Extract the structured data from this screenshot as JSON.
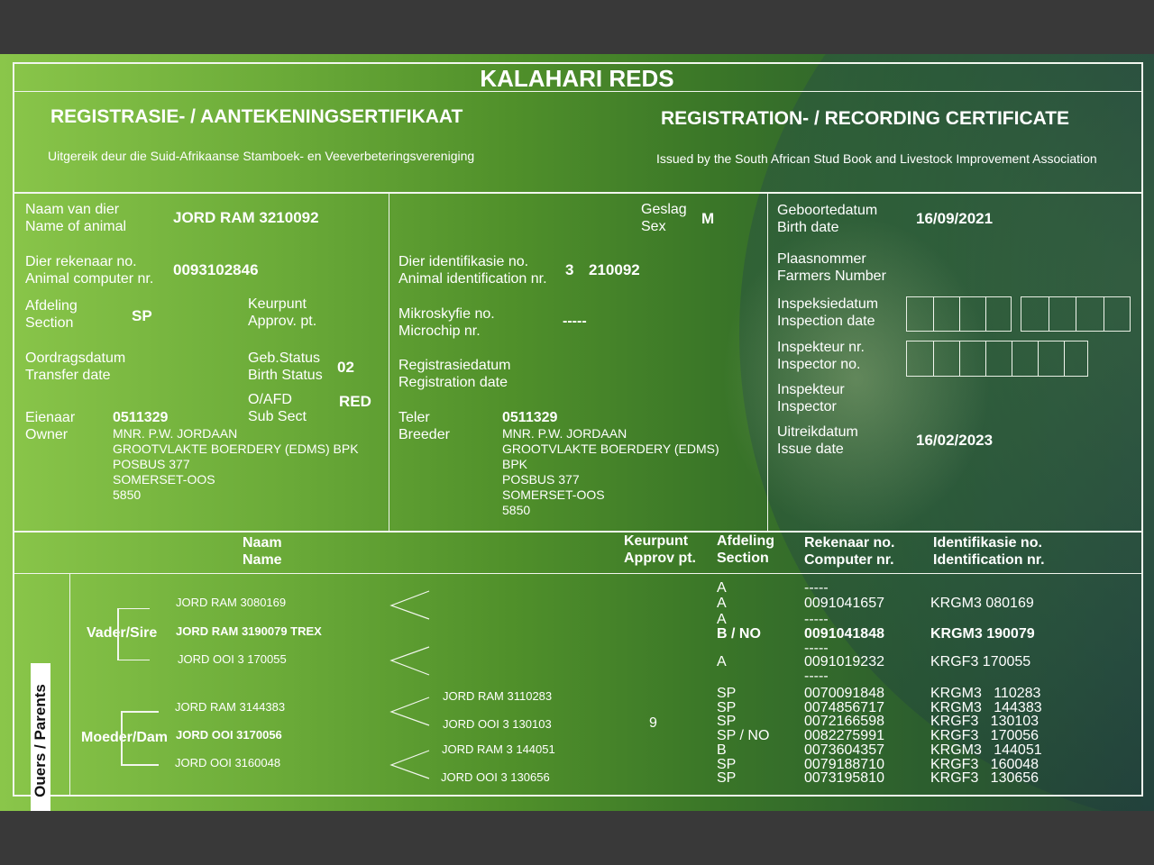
{
  "header": {
    "breed": "KALAHARI REDS",
    "title_af": "REGISTRASIE- / AANTEKENINGSERTIFIKAAT",
    "title_en": "REGISTRATION- / RECORDING CERTIFICATE",
    "issuer_af": "Uitgereik deur die Suid-Afrikaanse Stamboek- en Veeverbeteringsvereniging",
    "issuer_en": "Issued by the South African Stud Book and Livestock Improvement Association"
  },
  "labels": {
    "name_af": "Naam van dier",
    "name_en": "Name of animal",
    "comp_af": "Dier rekenaar no.",
    "comp_en": "Animal computer nr.",
    "section_af": "Afdeling",
    "section_en": "Section",
    "approv_af": "Keurpunt",
    "approv_en": "Approv. pt.",
    "transfer_af": "Oordragsdatum",
    "transfer_en": "Transfer date",
    "birthstatus_af": "Geb.Status",
    "birthstatus_en": "Birth Status",
    "subsect_af": "O/AFD",
    "subsect_en": "Sub Sect",
    "owner_af": "Eienaar",
    "owner_en": "Owner",
    "sex_af": "Geslag",
    "sex_en": "Sex",
    "ident_af": "Dier identifikasie no.",
    "ident_en": "Animal identification nr.",
    "micro_af": "Mikroskyfie no.",
    "micro_en": "Microchip nr.",
    "regdate_af": "Registrasiedatum",
    "regdate_en": "Registration date",
    "breeder_af": "Teler",
    "breeder_en": "Breeder",
    "birth_af": "Geboortedatum",
    "birth_en": "Birth date",
    "farm_af": "Plaasnommer",
    "farm_en": "Farmers Number",
    "inspdate_af": "Inspeksiedatum",
    "inspdate_en": "Inspection date",
    "inspno_af": "Inspekteur nr.",
    "inspno_en": "Inspector no.",
    "insp_af": "Inspekteur",
    "insp_en": "Inspector",
    "issue_af": "Uitreikdatum",
    "issue_en": "Issue date"
  },
  "animal": {
    "name": "JORD RAM 3210092",
    "computer_no": "0093102846",
    "section": "SP",
    "birth_status": "02",
    "sub_sect": "RED",
    "sex": "M",
    "id_prefix": "3",
    "id_no": "210092",
    "microchip": "-----",
    "birth_date": "16/09/2021",
    "issue_date": "16/02/2023"
  },
  "owner": {
    "code": "0511329",
    "lines": [
      "MNR. P.W. JORDAAN",
      "GROOTVLAKTE BOERDERY (EDMS) BPK",
      "POSBUS 377",
      "SOMERSET-OOS",
      "5850"
    ]
  },
  "breeder": {
    "code": "0511329",
    "lines": [
      "MNR. P.W. JORDAAN",
      "GROOTVLAKTE BOERDERY (EDMS)",
      "BPK",
      "POSBUS 377",
      "SOMERSET-OOS",
      "5850"
    ]
  },
  "pedigree_header": {
    "name_af": "Naam",
    "name_en": "Name",
    "approv_af": "Keurpunt",
    "approv_en": "Approv pt.",
    "section_af": "Afdeling",
    "section_en": "Section",
    "comp_af": "Rekenaar no.",
    "comp_en": "Computer nr.",
    "ident_af": "Identifikasie no.",
    "ident_en": "Identification nr."
  },
  "pedigree": {
    "side_label": "Ouers / Parents",
    "sire_label": "Vader/Sire",
    "dam_label": "Moeder/Dam",
    "sire": "JORD RAM 3190079 TREX",
    "sire_sire": "JORD RAM 3080169",
    "sire_dam": "JORD OOI 3 170055",
    "dam": "JORD OOI 3170056",
    "dam_sire": "JORD RAM 3144383",
    "dam_dam": "JORD OOI 3160048",
    "dam_sire_sire": "JORD RAM 3110283",
    "dam_sire_dam": "JORD OOI 3 130103",
    "dam_dam_sire": "JORD RAM 3 144051",
    "dam_dam_dam": "JORD OOI 3 130656",
    "dam_approv": "9",
    "sire_rows": [
      {
        "section": "A",
        "computer": "-----",
        "ident": ""
      },
      {
        "section": "A",
        "computer": "0091041657",
        "ident": "KRGM3   080169"
      },
      {
        "section": "A",
        "computer": "-----",
        "ident": ""
      },
      {
        "section": "B / NO",
        "computer": "0091041848",
        "ident": "KRGM3   190079"
      },
      {
        "section": "",
        "computer": "-----",
        "ident": ""
      },
      {
        "section": "A",
        "computer": "0091019232",
        "ident": "KRGF3   170055"
      },
      {
        "section": "",
        "computer": "-----",
        "ident": ""
      }
    ],
    "dam_sections": "SP\nSP\nSP\nSP / NO\nB\nSP\nSP",
    "dam_computers": "0070091848\n0074856717\n0072166598\n0082275991\n0073604357\n0079188710\n0073195810",
    "dam_idents": "KRGM3   110283\nKRGM3   144383\nKRGF3   130103\nKRGF3   170056\nKRGM3   144051\nKRGF3   160048\nKRGF3   130656"
  }
}
